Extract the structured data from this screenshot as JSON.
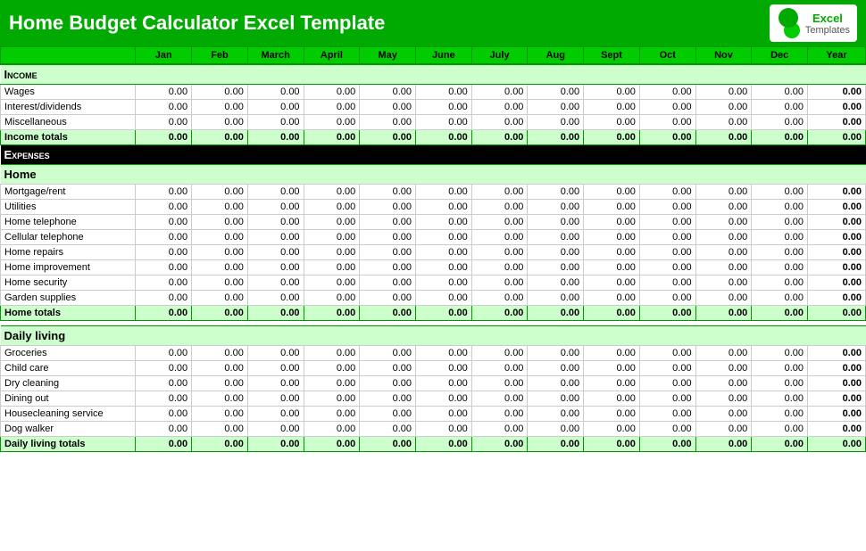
{
  "header": {
    "title": "Home Budget Calculator Excel Template",
    "logo_line1": "Excel",
    "logo_line2": "Templates"
  },
  "columns": {
    "label": "",
    "months": [
      "Jan",
      "Feb",
      "March",
      "April",
      "May",
      "June",
      "July",
      "Aug",
      "Sept",
      "Oct",
      "Nov",
      "Dec"
    ],
    "year": "Year"
  },
  "income": {
    "section_title": "Income",
    "rows": [
      {
        "label": "Wages"
      },
      {
        "label": "Interest/dividends"
      },
      {
        "label": "Miscellaneous"
      }
    ],
    "totals_label": "Income totals"
  },
  "expenses": {
    "section_title": "Expenses",
    "home": {
      "section_title": "Home",
      "rows": [
        {
          "label": "Mortgage/rent"
        },
        {
          "label": "Utilities"
        },
        {
          "label": "Home telephone"
        },
        {
          "label": "Cellular telephone"
        },
        {
          "label": "Home repairs"
        },
        {
          "label": "Home improvement"
        },
        {
          "label": "Home security"
        },
        {
          "label": "Garden supplies"
        }
      ],
      "totals_label": "Home totals"
    },
    "daily": {
      "section_title": "Daily living",
      "rows": [
        {
          "label": "Groceries"
        },
        {
          "label": "Child care"
        },
        {
          "label": "Dry cleaning"
        },
        {
          "label": "Dining out"
        },
        {
          "label": "Housecleaning service"
        },
        {
          "label": "Dog walker"
        }
      ],
      "totals_label": "Daily living totals"
    }
  },
  "zero": "0.00",
  "bold_zero": "0.00"
}
